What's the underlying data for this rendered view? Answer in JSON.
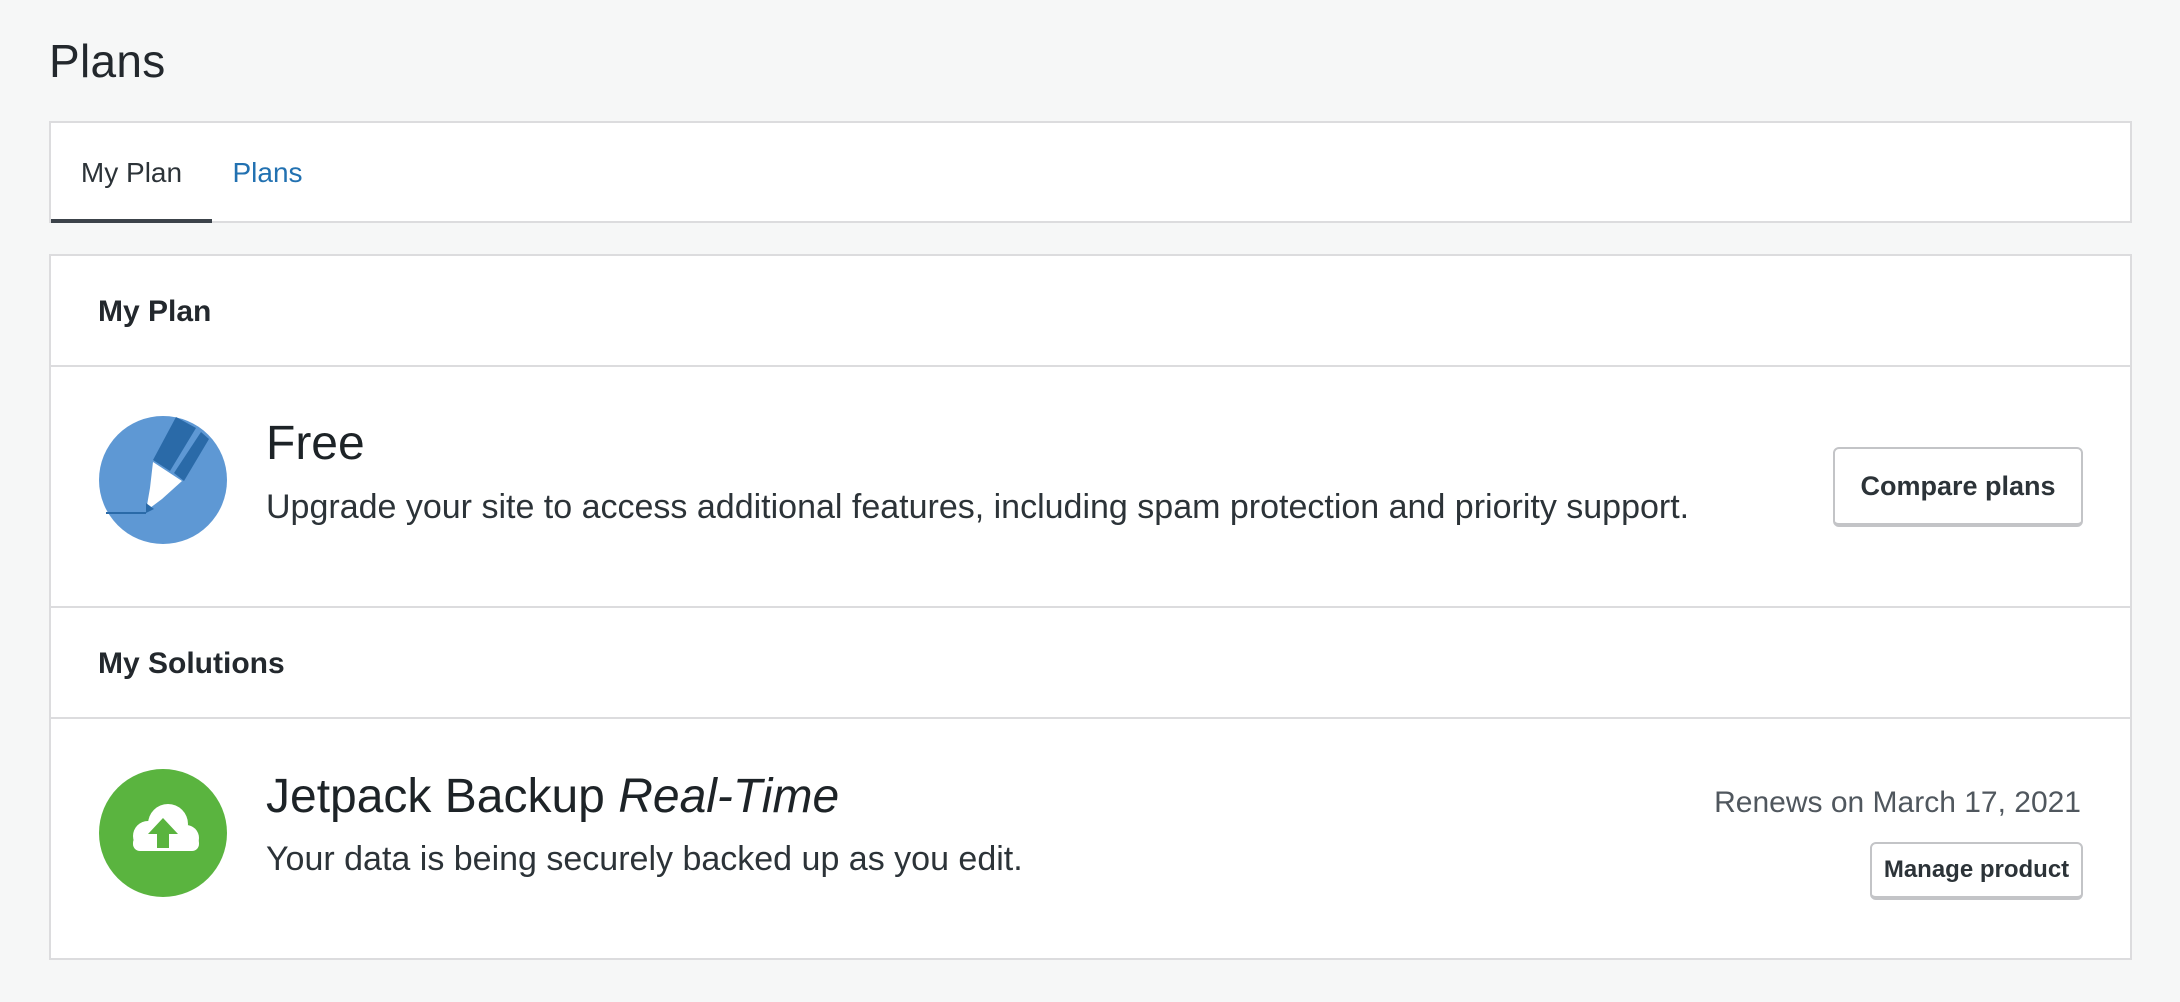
{
  "page": {
    "title": "Plans"
  },
  "tabs": [
    {
      "label": "My Plan",
      "active": true
    },
    {
      "label": "Plans",
      "active": false
    }
  ],
  "my_plan": {
    "header": "My Plan",
    "plan": {
      "icon": "free-plan-pencil-icon",
      "name": "Free",
      "description": "Upgrade your site to access additional features, including spam protection and priority support.",
      "button_label": "Compare plans"
    }
  },
  "my_solutions": {
    "header": "My Solutions",
    "product": {
      "icon": "cloud-upload-icon",
      "name_main": "Jetpack Backup ",
      "name_italic": "Real-Time",
      "description": "Your data is being securely backed up as you edit.",
      "renewal": "Renews on March 17, 2021",
      "button_label": "Manage product"
    }
  },
  "colors": {
    "tab_link": "#2271b1",
    "plan_icon_blue": "#5e98d4",
    "plan_icon_dark": "#2a6aa8",
    "backup_icon_green": "#5ab43f",
    "border": "#dcdcde",
    "background": "#f6f7f7"
  }
}
